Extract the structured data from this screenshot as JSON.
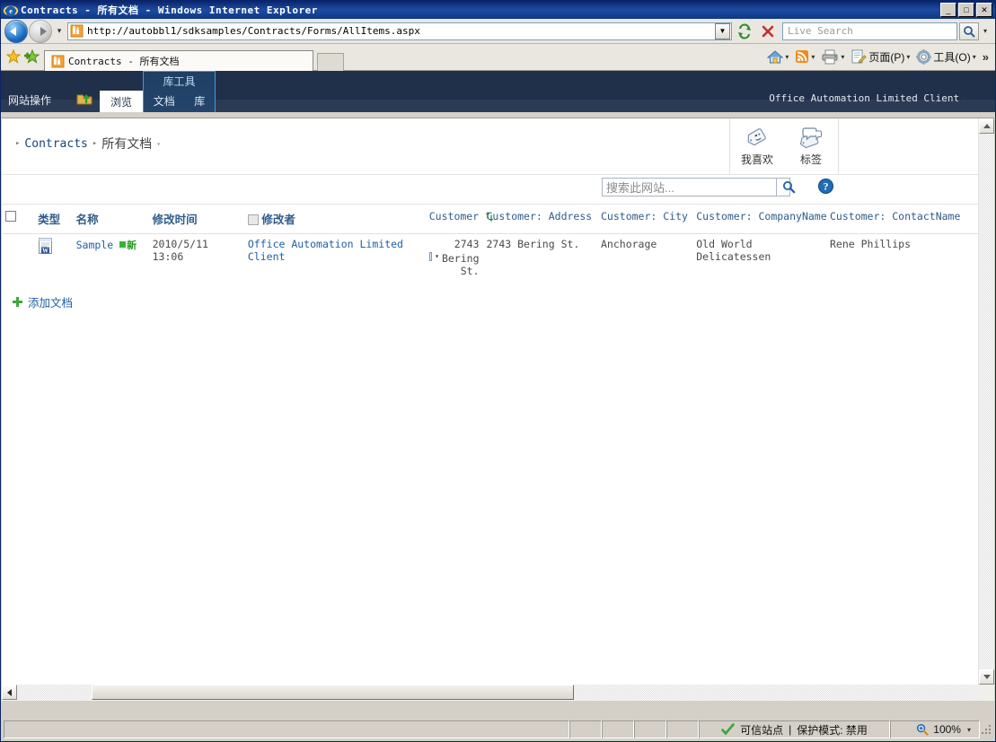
{
  "window": {
    "title": "Contracts - 所有文档 - Windows Internet Explorer",
    "minimize_label": "_",
    "maximize_label": "□",
    "close_label": "✕"
  },
  "address_bar": {
    "url": "http://autobbl1/sdksamples/Contracts/Forms/AllItems.aspx",
    "dropdown_caret": "▾",
    "back_tooltip": "后退",
    "forward_tooltip": "前进",
    "refresh_icon": "refresh-icon",
    "stop_icon": "stop-icon",
    "search_placeholder": "Live Search",
    "search_dropdown_caret": "▾"
  },
  "tab_bar": {
    "favorites_icon": "favorites-star-icon",
    "add_favorite_icon": "add-favorite-icon",
    "tab_title": "Contracts - 所有文档",
    "new_tab_label": ""
  },
  "command_bar": {
    "items": [
      {
        "name": "home",
        "label": "",
        "icon": "home-icon",
        "caret": "▾"
      },
      {
        "name": "feeds",
        "label": "",
        "icon": "rss-icon",
        "caret": "▾"
      },
      {
        "name": "print",
        "label": "",
        "icon": "printer-icon",
        "caret": "▾"
      },
      {
        "name": "page",
        "label": "页面(P)",
        "icon": "page-icon",
        "caret": "▾"
      },
      {
        "name": "tools",
        "label": "工具(O)",
        "icon": "gear-icon",
        "caret": "▾"
      }
    ],
    "overflow": "»"
  },
  "ribbon": {
    "site_actions": "网站操作",
    "site_actions_caret": "▾",
    "navigate_up_icon": "navigate-up-icon",
    "browse_tab": "浏览",
    "group_title": "库工具",
    "group_tabs": [
      "文档",
      "库"
    ],
    "user_name": "Office Automation Limited Client",
    "user_caret": "▾"
  },
  "breadcrumb": {
    "arrow": "▸",
    "site": "Contracts",
    "current": "所有文档",
    "current_caret": "▾"
  },
  "social": {
    "items": [
      {
        "label": "我喜欢",
        "icon": "i-like-it-icon"
      },
      {
        "label": "标签",
        "icon": "tags-and-notes-icon"
      }
    ]
  },
  "site_search": {
    "placeholder": "搜索此网站...",
    "search_icon": "search-icon",
    "help_icon": "help-icon"
  },
  "list_view": {
    "columns": [
      {
        "key": "select",
        "label": "",
        "type": "checkbox"
      },
      {
        "key": "type",
        "label": "类型",
        "cjk": true
      },
      {
        "key": "name",
        "label": "名称",
        "cjk": true
      },
      {
        "key": "modified",
        "label": "修改时间",
        "cjk": true
      },
      {
        "key": "modified_by",
        "label": "修改者",
        "cjk": true,
        "checkbox": true
      },
      {
        "key": "customer",
        "label": "Customer",
        "sort_icon": "sort-icon"
      },
      {
        "key": "customer_address",
        "label": "Customer: Address"
      },
      {
        "key": "customer_city",
        "label": "Customer: City"
      },
      {
        "key": "customer_company",
        "label": "Customer: CompanyName"
      },
      {
        "key": "customer_contact",
        "label": "Customer: ContactName"
      }
    ],
    "rows": [
      {
        "type_icon": "word-document-icon",
        "name": "Sample",
        "new_badge": "新",
        "modified": "2010/5/11 13:06",
        "modified_by": "Office Automation Limited Client",
        "customer": "2743",
        "customer_line2": "Bering",
        "customer_line3": "St.",
        "customer_address": "2743 Bering St.",
        "customer_city": "Anchorage",
        "customer_company": "Old World Delicatessen",
        "customer_contact": "Rene Phillips"
      }
    ],
    "add_document": "添加文档",
    "add_document_icon": "plus-icon"
  },
  "status_bar": {
    "zone_icon": "trusted-check-icon",
    "zone_text": "可信站点",
    "separator": "|",
    "protected_mode": "保护模式: 禁用",
    "zoom_icon": "zoom-icon",
    "zoom_level": "100%",
    "zoom_caret": "▾"
  }
}
